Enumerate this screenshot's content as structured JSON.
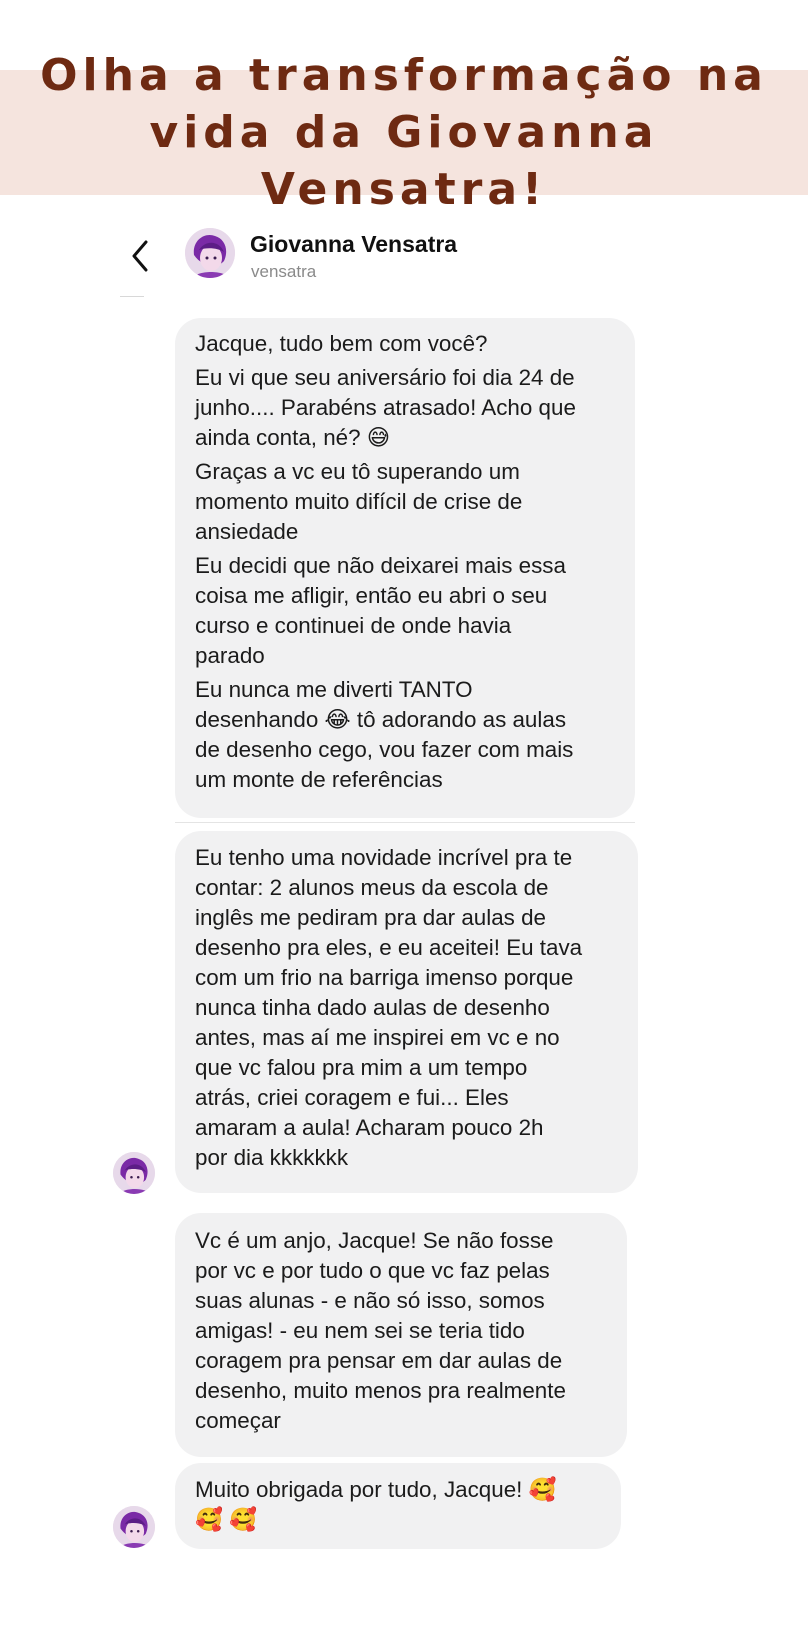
{
  "banner": {
    "title": "Olha a transformação na vida da Giovanna Vensatra!"
  },
  "colors": {
    "banner_bg": "#f5e4de",
    "banner_text": "#6e2a12",
    "bubble_bg": "#f1f1f2"
  },
  "header": {
    "back_icon": "chevron-left-icon",
    "name": "Giovanna Vensatra",
    "handle": "vensatra"
  },
  "messages": [
    {
      "paragraphs": [
        "Jacque, tudo bem com você?",
        "Eu vi que seu aniversário foi dia 24 de\njunho.... Parabéns atrasado! Acho que\nainda conta, né? 😅",
        "Graças a vc eu tô superando um\nmomento muito difícil de crise de\nansiedade",
        "Eu decidi que não deixarei mais essa\ncoisa me afligir, então eu abri o seu\ncurso e continuei de onde havia\nparado",
        "Eu nunca me diverti TANTO\ndesenhando 😂 tô adorando as aulas\nde desenho cego, vou fazer com mais\num monte de referências"
      ]
    },
    {
      "paragraphs": [
        "Eu tenho uma novidade incrível pra te\ncontar: 2 alunos meus da escola de\ninglês me pediram pra dar aulas de\ndesenho pra eles, e eu aceitei! Eu tava\ncom um frio na barriga imenso porque\nnunca tinha dado aulas de desenho\nantes, mas aí me inspirei em vc e no\nque vc falou pra mim a um tempo\natrás, criei coragem e fui... Eles\namaram a aula! Acharam pouco 2h\npor dia kkkkkkk"
      ]
    },
    {
      "paragraphs": [
        "Vc é um anjo, Jacque! Se não fosse\npor vc e por tudo o que vc faz pelas\nsuas alunas - e não só isso, somos\namigas! - eu nem sei se teria tido\ncoragem pra pensar em dar aulas de\ndesenho, muito menos pra realmente\ncomeçar"
      ]
    },
    {
      "paragraphs": [
        "Muito obrigada por tudo, Jacque! 🥰\n🥰 🥰"
      ]
    }
  ]
}
